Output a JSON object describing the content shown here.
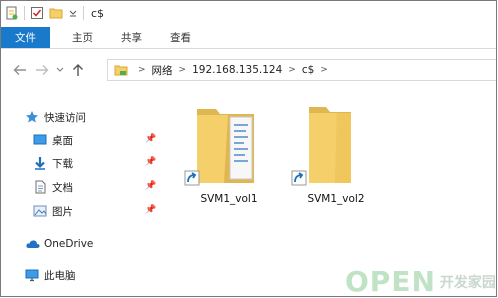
{
  "window": {
    "title": "c$"
  },
  "ribbon": {
    "tabs": [
      "文件",
      "主页",
      "共享",
      "查看"
    ]
  },
  "address": {
    "segments": [
      "网络",
      "192.168.135.124",
      "c$"
    ]
  },
  "nav": {
    "quick_access": "快速访问",
    "items": [
      "桌面",
      "下载",
      "文档",
      "图片"
    ],
    "onedrive": "OneDrive",
    "this_pc": "此电脑"
  },
  "files": [
    {
      "name": "SVM1_vol1"
    },
    {
      "name": "SVM1_vol2"
    }
  ],
  "watermark": {
    "brand": "OPEN",
    "suffix": "开发家园"
  },
  "colors": {
    "accent": "#1979ca",
    "folder": "#f5cf6a"
  }
}
